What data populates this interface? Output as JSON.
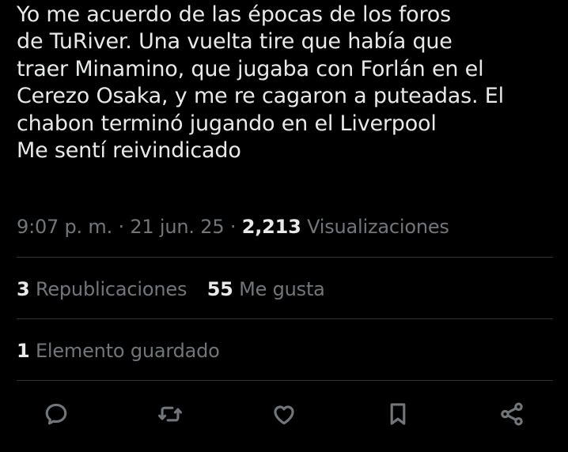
{
  "tweet": {
    "text_lines": [
      "Yo me acuerdo de las épocas de los foros",
      "de TuRiver. Una vuelta tire que había que",
      "traer Minamino, que jugaba con Forlán en el",
      "Cerezo Osaka, y me re cagaron a puteadas. El",
      "chabon terminó jugando en el Liverpool",
      "Me sentí reivindicado"
    ],
    "time": "9:07 p. m.",
    "separator": "·",
    "date": "21 jun. 25",
    "views_count": "2,213",
    "views_label": "Visualizaciones"
  },
  "stats": {
    "reposts_count": "3",
    "reposts_label": "Republicaciones",
    "likes_count": "55",
    "likes_label": "Me gusta",
    "bookmarks_count": "1",
    "bookmarks_label": "Elemento guardado"
  },
  "actions": {
    "reply_icon": "reply-icon",
    "repost_icon": "repost-icon",
    "like_icon": "like-icon",
    "bookmark_icon": "bookmark-icon",
    "share_icon": "share-icon"
  },
  "colors": {
    "background": "#000000",
    "text": "#e7e9ea",
    "secondary": "#71767b",
    "divider": "#2f3336"
  }
}
